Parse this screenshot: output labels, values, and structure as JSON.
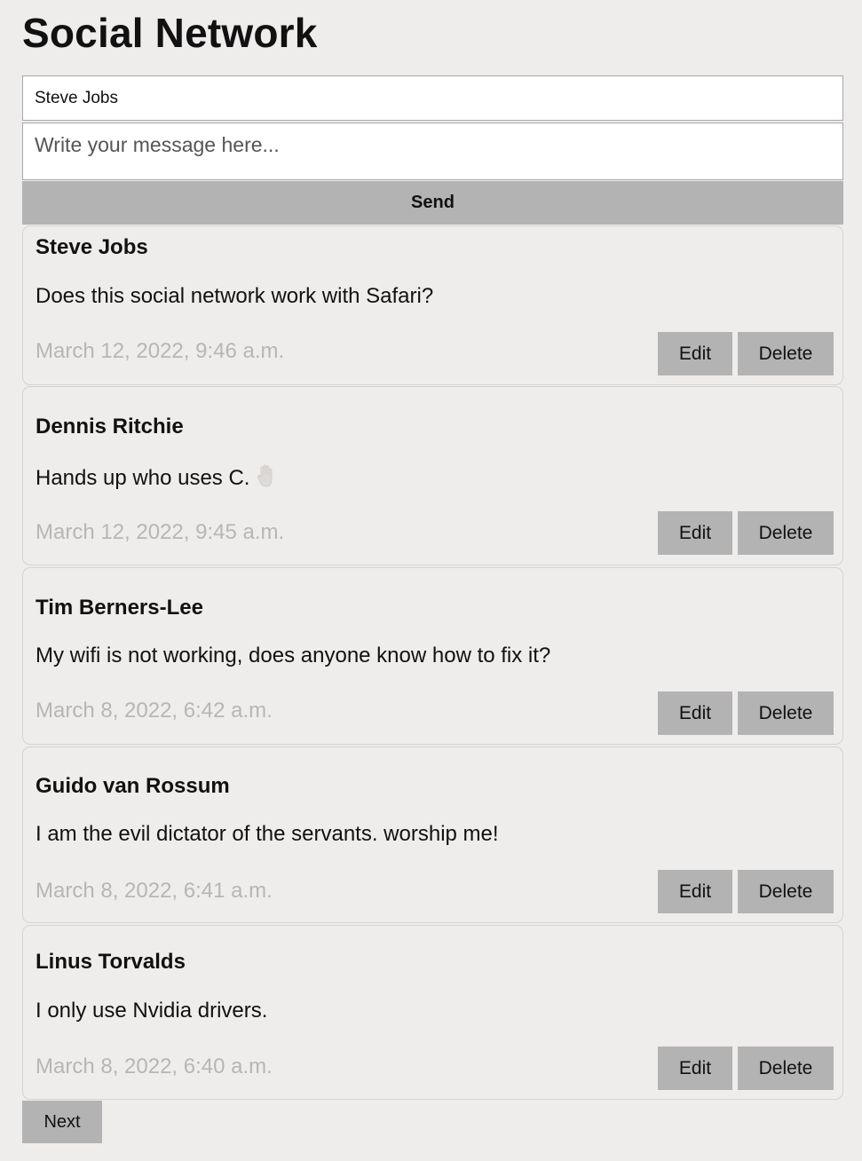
{
  "page_title": "Social Network",
  "form": {
    "author_value": "Steve Jobs",
    "message_placeholder": "Write your message here...",
    "send_label": "Send"
  },
  "posts": [
    {
      "author": "Steve Jobs",
      "text": "Does this social network work with Safari?",
      "date": "March 12, 2022, 9:46 a.m.",
      "edit_label": "Edit",
      "delete_label": "Delete"
    },
    {
      "author": "Dennis Ritchie",
      "text": "Hands up who uses C.",
      "icon": "raised-hand-icon",
      "date": "March 12, 2022, 9:45 a.m.",
      "edit_label": "Edit",
      "delete_label": "Delete"
    },
    {
      "author": "Tim Berners-Lee",
      "text": "My wifi is not working, does anyone know how to fix it?",
      "date": "March 8, 2022, 6:42 a.m.",
      "edit_label": "Edit",
      "delete_label": "Delete"
    },
    {
      "author": "Guido van Rossum",
      "text": "I am the evil dictator of the servants. worship me!",
      "date": "March 8, 2022, 6:41 a.m.",
      "edit_label": "Edit",
      "delete_label": "Delete"
    },
    {
      "author": "Linus Torvalds",
      "text": "I only use Nvidia drivers.",
      "date": "March 8, 2022, 6:40 a.m.",
      "edit_label": "Edit",
      "delete_label": "Delete"
    }
  ],
  "pagination": {
    "next_label": "Next"
  },
  "colors": {
    "background": "#efecec",
    "button": "#b3b3b3",
    "date_text": "#b6b6b6"
  }
}
